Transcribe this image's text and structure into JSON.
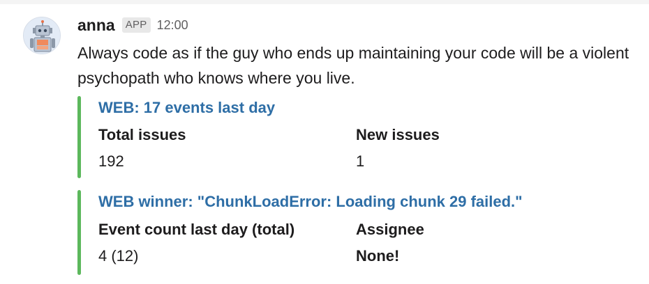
{
  "message": {
    "sender": "anna",
    "badge": "APP",
    "time": "12:00",
    "text": "Always code as if the guy who ends up maintaining your code will be a violent psychopath who knows where you live.",
    "avatar_icon": "robot-icon"
  },
  "attachments": [
    {
      "color": "#5cb85c",
      "title": "WEB: 17 events last day",
      "fields": [
        {
          "title": "Total issues",
          "value": "192"
        },
        {
          "title": "New issues",
          "value": "1"
        }
      ]
    },
    {
      "color": "#5cb85c",
      "title": "WEB winner: \"ChunkLoadError: Loading chunk 29 failed.\"",
      "fields": [
        {
          "title": "Event count last day (total)",
          "value": "4 (12)"
        },
        {
          "title": "Assignee",
          "value": "None!"
        }
      ]
    }
  ],
  "colors": {
    "link": "#2e6ea6",
    "attachment_bar": "#5cb85c",
    "text": "#1d1c1d",
    "muted": "#616061"
  }
}
